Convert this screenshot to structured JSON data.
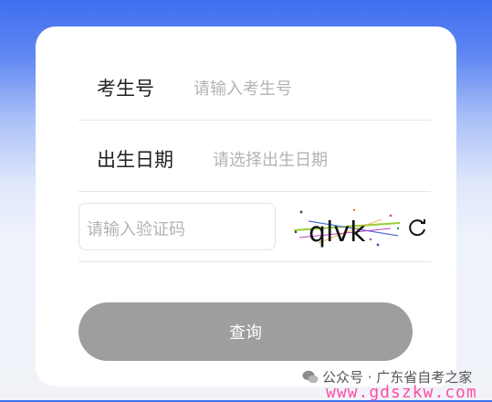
{
  "form": {
    "exam_number": {
      "label": "考生号",
      "placeholder": "请输入考生号"
    },
    "birth_date": {
      "label": "出生日期",
      "placeholder": "请选择出生日期"
    },
    "captcha": {
      "placeholder": "请输入验证码",
      "image_text": "qlvk",
      "refresh_icon": "refresh-icon"
    },
    "submit_label": "查询",
    "submit_color": "#9e9e9e"
  },
  "watermark": {
    "line1": "公众号 · 广东省自考之家",
    "line2": "www.gdszkw.com",
    "color": "#ff4da6",
    "icon": "wechat-icon"
  },
  "colors": {
    "background_top": "#3f6ff0",
    "card": "#ffffff"
  }
}
